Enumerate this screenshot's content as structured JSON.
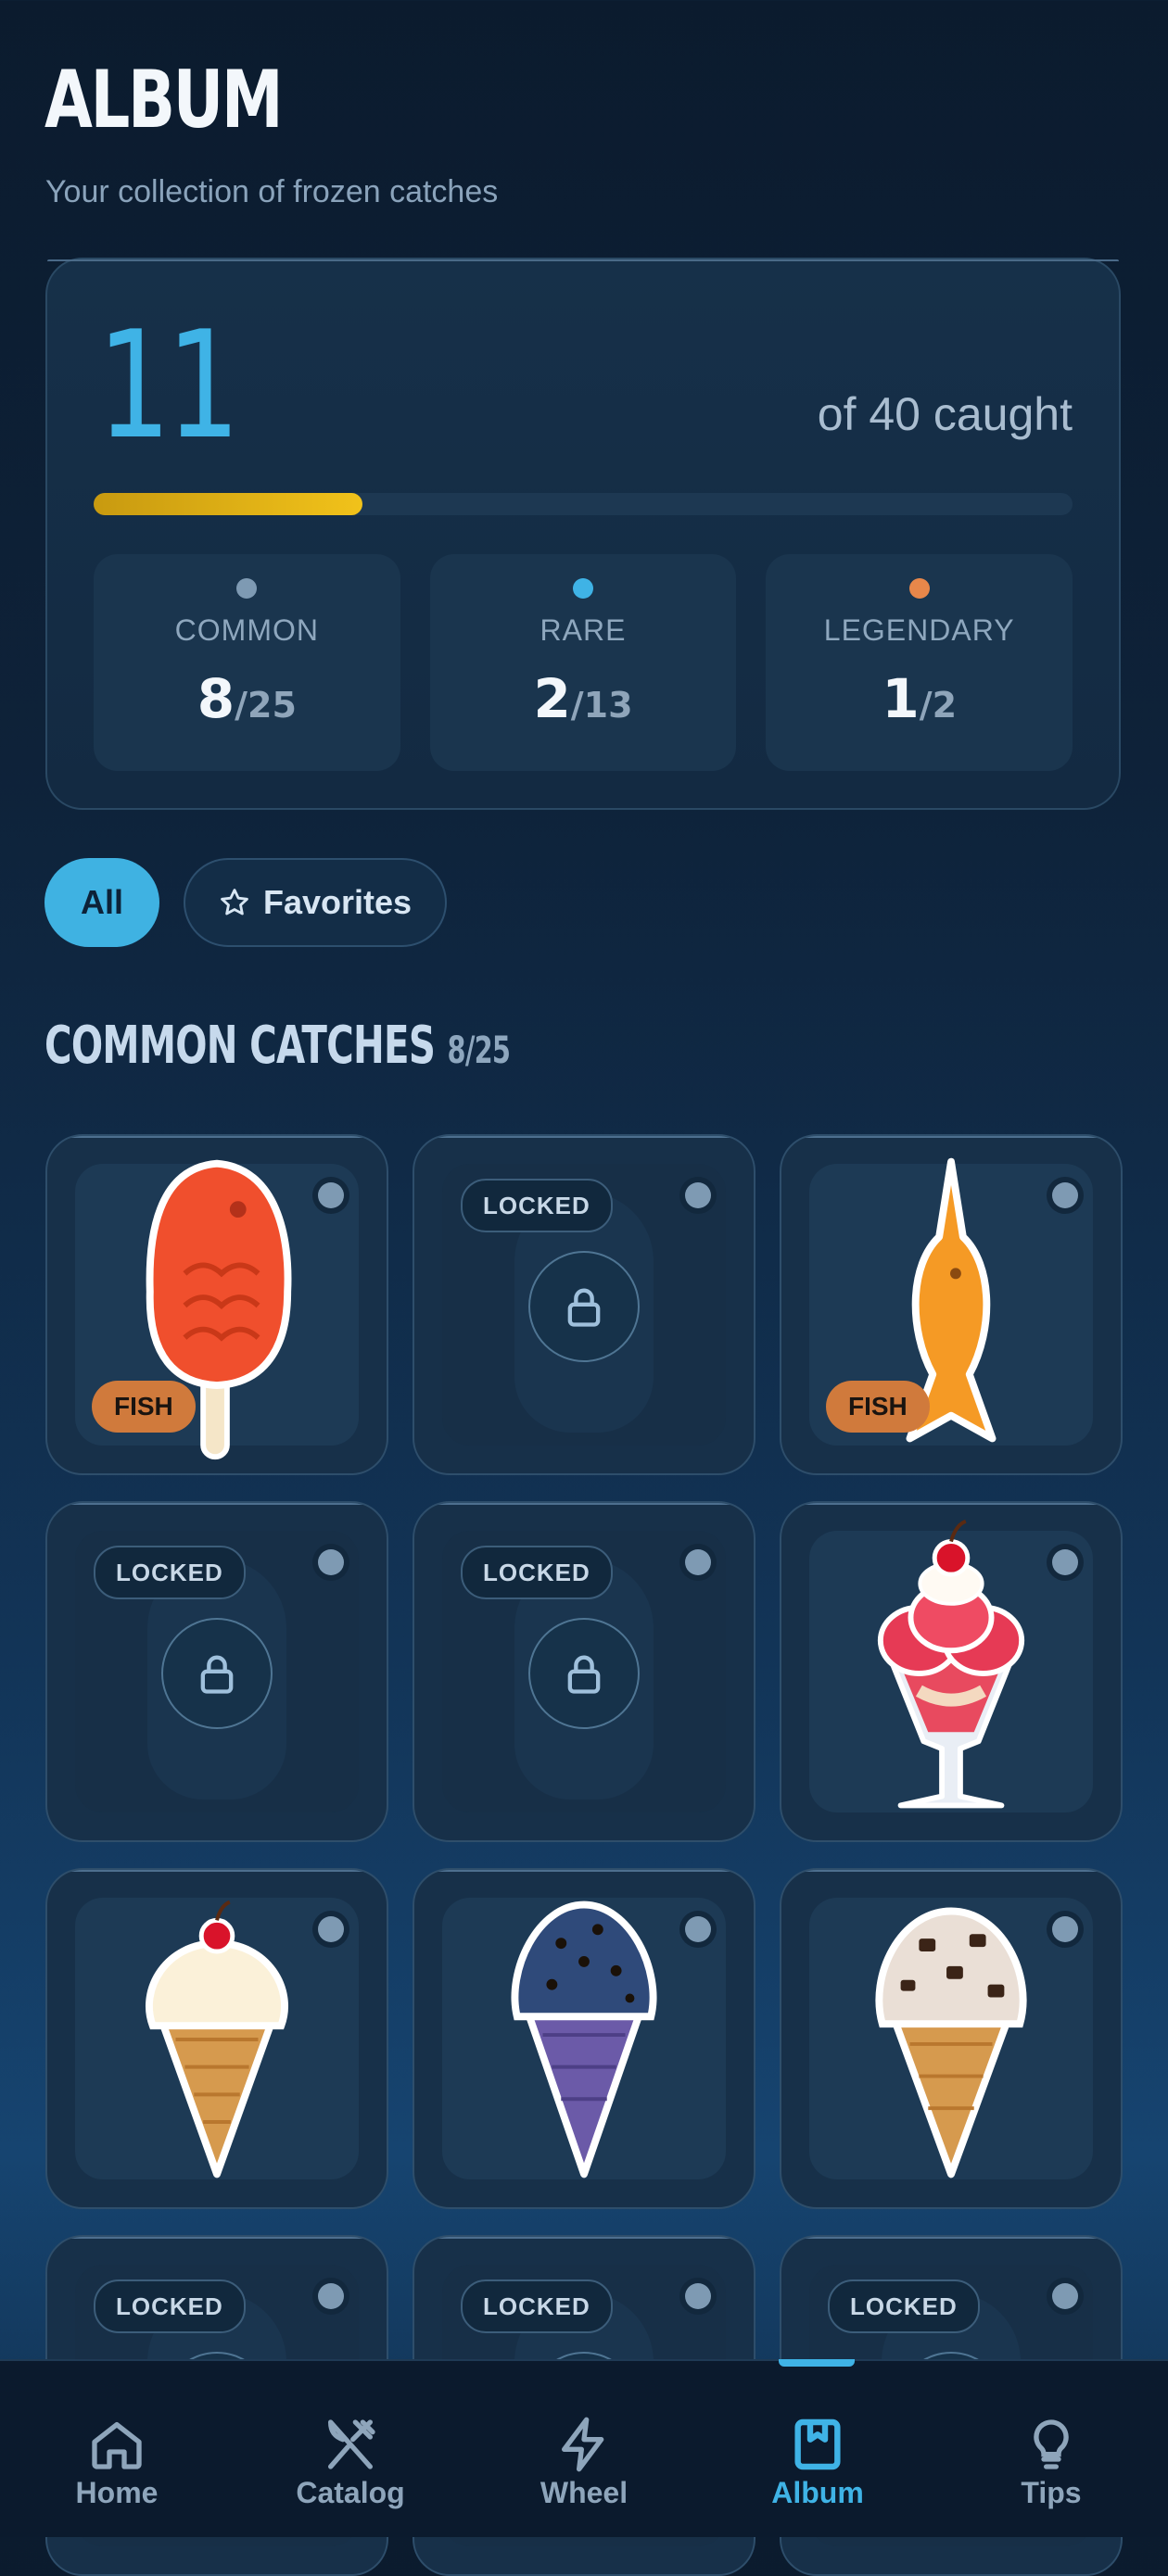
{
  "header": {
    "title": "ALBUM",
    "subtitle": "Your collection of frozen catches"
  },
  "summary": {
    "caught": "11",
    "of_total": "of 40 caught",
    "progress_fraction": 0.275,
    "progress_color": "#f1c21a",
    "rarities": [
      {
        "label": "COMMON",
        "count": "8",
        "total": "/25",
        "color": "#7e9ab3"
      },
      {
        "label": "RARE",
        "count": "2",
        "total": "/13",
        "color": "#3fb3e6"
      },
      {
        "label": "LEGENDARY",
        "count": "1",
        "total": "/2",
        "color": "#e8874a"
      }
    ]
  },
  "filters": {
    "all_label": "All",
    "favorites_label": "Favorites",
    "favorites_icon": "star-icon"
  },
  "section": {
    "title": "COMMON CATCHES",
    "count": "8/25"
  },
  "grid": {
    "tiles": [
      {
        "state": "unlocked",
        "item": "red-fish-popsicle",
        "badge": "FISH"
      },
      {
        "state": "locked",
        "badge": "LOCKED"
      },
      {
        "state": "unlocked",
        "item": "orange-swordfish-popsicle",
        "badge": "FISH"
      },
      {
        "state": "locked",
        "badge": "LOCKED"
      },
      {
        "state": "locked",
        "badge": "LOCKED"
      },
      {
        "state": "unlocked",
        "item": "strawberry-sundae"
      },
      {
        "state": "unlocked",
        "item": "vanilla-cherry-cone"
      },
      {
        "state": "unlocked",
        "item": "blueberry-chip-cone"
      },
      {
        "state": "unlocked",
        "item": "cookies-and-cream-cone"
      },
      {
        "state": "locked",
        "badge": "LOCKED"
      },
      {
        "state": "locked",
        "badge": "LOCKED"
      },
      {
        "state": "locked",
        "badge": "LOCKED"
      }
    ]
  },
  "nav": {
    "items": [
      {
        "label": "Home",
        "icon": "home-icon"
      },
      {
        "label": "Catalog",
        "icon": "catalog-icon"
      },
      {
        "label": "Wheel",
        "icon": "bolt-icon"
      },
      {
        "label": "Album",
        "icon": "album-icon",
        "active": true
      },
      {
        "label": "Tips",
        "icon": "lightbulb-icon"
      }
    ]
  }
}
